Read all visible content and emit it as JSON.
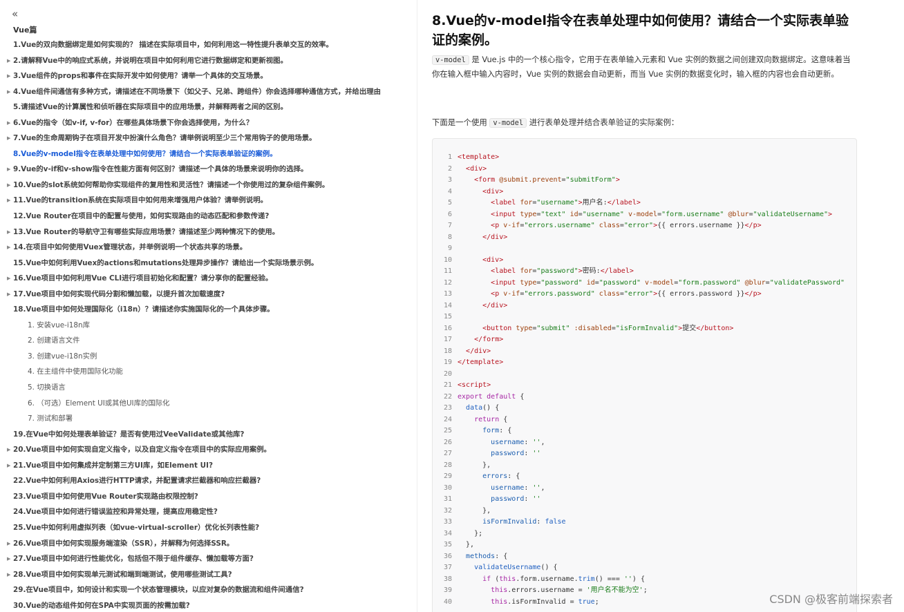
{
  "sidebar": {
    "collapse_icon": "chevron-double-left-icon",
    "section_title": "Vue篇",
    "items": [
      {
        "label": "1.Vue的双向数据绑定是如何实现的？ 描述在实际项目中，如何利用这一特性提升表单交互的效率。",
        "arrow": false
      },
      {
        "label": "2.请解释Vue中的响应式系统，并说明在项目中如何利用它进行数据绑定和更新视图。",
        "arrow": true
      },
      {
        "label": "3.Vue组件的props和事件在实际开发中如何使用？请举一个具体的交互场景。",
        "arrow": true
      },
      {
        "label": "4.Vue组件间通信有多种方式，请描述在不同场景下（如父子、兄弟、跨组件）你会选择哪种通信方式，并给出理由",
        "arrow": true
      },
      {
        "label": "5.请描述Vue的计算属性和侦听器在实际项目中的应用场景，并解释两者之间的区别。",
        "arrow": false
      },
      {
        "label": "6.Vue的指令（如v-if, v-for）在哪些具体场景下你会选择使用，为什么？",
        "arrow": true
      },
      {
        "label": "7.Vue的生命周期钩子在项目开发中扮演什么角色？请举例说明至少三个常用钩子的使用场景。",
        "arrow": true
      },
      {
        "label": "8.Vue的v-model指令在表单处理中如何使用？请结合一个实际表单验证的案例。",
        "arrow": false,
        "active": true
      },
      {
        "label": "9.Vue的v-if和v-show指令在性能方面有何区别？请描述一个具体的场景来说明你的选择。",
        "arrow": true
      },
      {
        "label": "10.Vue的slot系统如何帮助你实现组件的复用性和灵活性？请描述一个你使用过的复杂组件案例。",
        "arrow": true
      },
      {
        "label": "11.Vue的transition系统在实际项目中如何用来增强用户体验？请举例说明。",
        "arrow": true
      },
      {
        "label": "12.Vue Router在项目中的配置与使用，如何实现路由的动态匹配和参数传递?",
        "arrow": false
      },
      {
        "label": "13.Vue Router的导航守卫有哪些实际应用场景？请描述至少两种情况下的使用。",
        "arrow": true
      },
      {
        "label": "14.在项目中如何使用Vuex管理状态，并举例说明一个状态共享的场景。",
        "arrow": true
      },
      {
        "label": "15.Vue中如何利用Vuex的actions和mutations处理异步操作？请给出一个实际场景示例。",
        "arrow": false
      },
      {
        "label": "16.Vue项目中如何利用Vue CLI进行项目初始化和配置？请分享你的配置经验。",
        "arrow": true
      },
      {
        "label": "17.Vue项目中如何实现代码分割和懒加载，以提升首次加载速度?",
        "arrow": true
      },
      {
        "label": "18.Vue项目中如何处理国际化（i18n）？请描述你实施国际化的一个具体步骤。",
        "arrow": false
      },
      {
        "label": "1. 安装vue-i18n库",
        "sub": true
      },
      {
        "label": "2. 创建语言文件",
        "sub": true
      },
      {
        "label": "3. 创建vue-i18n实例",
        "sub": true
      },
      {
        "label": "4. 在主组件中使用国际化功能",
        "sub": true
      },
      {
        "label": "5. 切换语言",
        "sub": true
      },
      {
        "label": "6. （可选）Element UI或其他UI库的国际化",
        "sub": true
      },
      {
        "label": "7. 测试和部署",
        "sub": true
      },
      {
        "label": "19.在Vue中如何处理表单验证？是否有使用过VeeValidate或其他库?",
        "arrow": false
      },
      {
        "label": "20.Vue项目中如何实现自定义指令，以及自定义指令在项目中的实际应用案例。",
        "arrow": true
      },
      {
        "label": "21.Vue项目中如何集成并定制第三方UI库，如Element UI?",
        "arrow": true
      },
      {
        "label": "22.Vue中如何利用Axios进行HTTP请求，并配置请求拦截器和响应拦截器?",
        "arrow": false
      },
      {
        "label": "23.Vue项目中如何使用Vue Router实现路由权限控制?",
        "arrow": false
      },
      {
        "label": "24.Vue项目中如何进行错误监控和异常处理，提高应用稳定性?",
        "arrow": false
      },
      {
        "label": "25.Vue中如何利用虚拟列表（如vue-virtual-scroller）优化长列表性能?",
        "arrow": false
      },
      {
        "label": "26.Vue项目中如何实现服务端渲染（SSR），并解释为何选择SSR。",
        "arrow": true
      },
      {
        "label": "27.Vue项目中如何进行性能优化，包括但不限于组件缓存、懒加载等方面?",
        "arrow": true
      },
      {
        "label": "28.Vue项目中如何实现单元测试和端到端测试，使用哪些测试工具?",
        "arrow": true
      },
      {
        "label": "29.在Vue项目中，如何设计和实现一个状态管理模块，以应对复杂的数据流和组件间通信?",
        "arrow": false
      },
      {
        "label": "30.Vue的动态组件如何在SPA中实现页面的按需加载?",
        "arrow": false
      }
    ]
  },
  "main": {
    "title": "8.Vue的v-model指令在表单处理中如何使用？请结合一个实际表单验证的案例。",
    "intro_code": "v-model",
    "intro_text": " 是 Vue.js 中的一个核心指令，它用于在表单输入元素和 Vue 实例的数据之间创建双向数据绑定。这意味着当你在输入框中输入内容时，Vue 实例的数据会自动更新，而当 Vue 实例的数据变化时，输入框的内容也会自动更新。",
    "example_prefix": "下面是一个使用 ",
    "example_code": "v-model",
    "example_suffix": " 进行表单处理并结合表单验证的实际案例："
  },
  "code": [
    {
      "n": "1",
      "h": "<span class='t'>&lt;template&gt;</span>"
    },
    {
      "n": "2",
      "h": "  <span class='t'>&lt;div&gt;</span>"
    },
    {
      "n": "3",
      "h": "    <span class='t'>&lt;form</span> <span class='a'>@submit.prevent</span>=<span class='s'>\"submitForm\"</span><span class='t'>&gt;</span>"
    },
    {
      "n": "4",
      "h": "      <span class='t'>&lt;div&gt;</span>"
    },
    {
      "n": "5",
      "h": "        <span class='t'>&lt;label</span> <span class='a'>for</span>=<span class='s'>\"username\"</span><span class='t'>&gt;</span>用户名:<span class='t'>&lt;/label&gt;</span>"
    },
    {
      "n": "6",
      "h": "        <span class='t'>&lt;input</span> <span class='a'>type</span>=<span class='s'>\"text\"</span> <span class='a'>id</span>=<span class='s'>\"username\"</span> <span class='a'>v-model</span>=<span class='s'>\"form.username\"</span> <span class='a'>@blur</span>=<span class='s'>\"validateUsername\"</span><span class='t'>&gt;</span>"
    },
    {
      "n": "7",
      "h": "        <span class='t'>&lt;p</span> <span class='a'>v-if</span>=<span class='s'>\"errors.username\"</span> <span class='a'>class</span>=<span class='s'>\"error\"</span><span class='t'>&gt;</span>{{ errors.username }}<span class='t'>&lt;/p&gt;</span>"
    },
    {
      "n": "8",
      "h": "      <span class='t'>&lt;/div&gt;</span>"
    },
    {
      "n": "9",
      "h": ""
    },
    {
      "n": "10",
      "h": "      <span class='t'>&lt;div&gt;</span>"
    },
    {
      "n": "11",
      "h": "        <span class='t'>&lt;label</span> <span class='a'>for</span>=<span class='s'>\"password\"</span><span class='t'>&gt;</span>密码:<span class='t'>&lt;/label&gt;</span>"
    },
    {
      "n": "12",
      "h": "        <span class='t'>&lt;input</span> <span class='a'>type</span>=<span class='s'>\"password\"</span> <span class='a'>id</span>=<span class='s'>\"password\"</span> <span class='a'>v-model</span>=<span class='s'>\"form.password\"</span> <span class='a'>@blur</span>=<span class='s'>\"validatePassword\"</span>"
    },
    {
      "n": "13",
      "h": "        <span class='t'>&lt;p</span> <span class='a'>v-if</span>=<span class='s'>\"errors.password\"</span> <span class='a'>class</span>=<span class='s'>\"error\"</span><span class='t'>&gt;</span>{{ errors.password }}<span class='t'>&lt;/p&gt;</span>"
    },
    {
      "n": "14",
      "h": "      <span class='t'>&lt;/div&gt;</span>"
    },
    {
      "n": "15",
      "h": ""
    },
    {
      "n": "16",
      "h": "      <span class='t'>&lt;button</span> <span class='a'>type</span>=<span class='s'>\"submit\"</span> <span class='a'>:disabled</span>=<span class='s'>\"isFormInvalid\"</span><span class='t'>&gt;</span>提交<span class='t'>&lt;/button&gt;</span>"
    },
    {
      "n": "17",
      "h": "    <span class='t'>&lt;/form&gt;</span>"
    },
    {
      "n": "18",
      "h": "  <span class='t'>&lt;/div&gt;</span>"
    },
    {
      "n": "19",
      "h": "<span class='t'>&lt;/template&gt;</span>"
    },
    {
      "n": "20",
      "h": ""
    },
    {
      "n": "21",
      "h": "<span class='t'>&lt;script&gt;</span>"
    },
    {
      "n": "22",
      "h": "<span class='k'>export default</span> {"
    },
    {
      "n": "23",
      "h": "  <span class='f'>data</span>() {"
    },
    {
      "n": "24",
      "h": "    <span class='k'>return</span> {"
    },
    {
      "n": "25",
      "h": "      <span class='p'>form</span>: {"
    },
    {
      "n": "26",
      "h": "        <span class='p'>username</span>: <span class='s'>''</span>,"
    },
    {
      "n": "27",
      "h": "        <span class='p'>password</span>: <span class='s'>''</span>"
    },
    {
      "n": "28",
      "h": "      },"
    },
    {
      "n": "29",
      "h": "      <span class='p'>errors</span>: {"
    },
    {
      "n": "30",
      "h": "        <span class='p'>username</span>: <span class='s'>''</span>,"
    },
    {
      "n": "31",
      "h": "        <span class='p'>password</span>: <span class='s'>''</span>"
    },
    {
      "n": "32",
      "h": "      },"
    },
    {
      "n": "33",
      "h": "      <span class='p'>isFormInvalid</span>: <span class='f'>false</span>"
    },
    {
      "n": "34",
      "h": "    };"
    },
    {
      "n": "35",
      "h": "  },"
    },
    {
      "n": "36",
      "h": "  <span class='p'>methods</span>: {"
    },
    {
      "n": "37",
      "h": "    <span class='f'>validateUsername</span>() {"
    },
    {
      "n": "38",
      "h": "      <span class='k'>if</span> (<span class='k'>this</span>.form.username.<span class='f'>trim</span>() === <span class='s'>''</span>) {"
    },
    {
      "n": "39",
      "h": "        <span class='k'>this</span>.errors.username = <span class='s'>'用户名不能为空'</span>;"
    },
    {
      "n": "40",
      "h": "        <span class='k'>this</span>.isFormInvalid = <span class='f'>true</span>;"
    }
  ],
  "watermark": "CSDN @极客前端探索者"
}
